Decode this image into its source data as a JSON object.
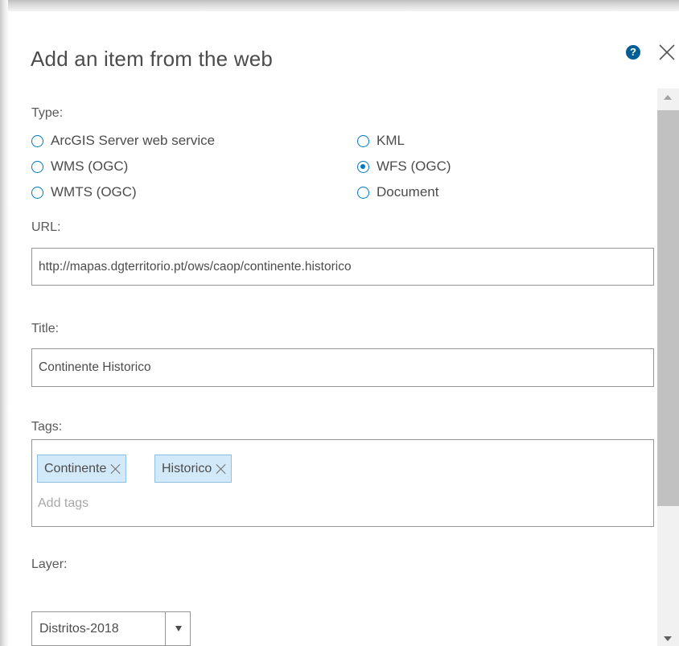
{
  "dialog": {
    "title": "Add an item from the web",
    "help_icon": "question-circle-icon",
    "close_icon": "close-icon"
  },
  "type": {
    "label": "Type:",
    "options": [
      {
        "label": "ArcGIS Server web service",
        "checked": false
      },
      {
        "label": "WMS (OGC)",
        "checked": false
      },
      {
        "label": "WMTS (OGC)",
        "checked": false
      },
      {
        "label": "KML",
        "checked": false
      },
      {
        "label": "WFS (OGC)",
        "checked": true
      },
      {
        "label": "Document",
        "checked": false
      }
    ]
  },
  "url": {
    "label": "URL:",
    "value": "http://mapas.dgterritorio.pt/ows/caop/continente.historico"
  },
  "title_field": {
    "label": "Title:",
    "value": "Continente Historico"
  },
  "tags": {
    "label": "Tags:",
    "items": [
      "Continente",
      "Historico"
    ],
    "placeholder": "Add tags"
  },
  "layer": {
    "label": "Layer:",
    "selected": "Distritos-2018"
  },
  "colors": {
    "accent": "#0079c1",
    "help_icon_bg": "#005e95",
    "tag_bg": "#d2e9f9",
    "tag_border": "#8fc0e3"
  }
}
